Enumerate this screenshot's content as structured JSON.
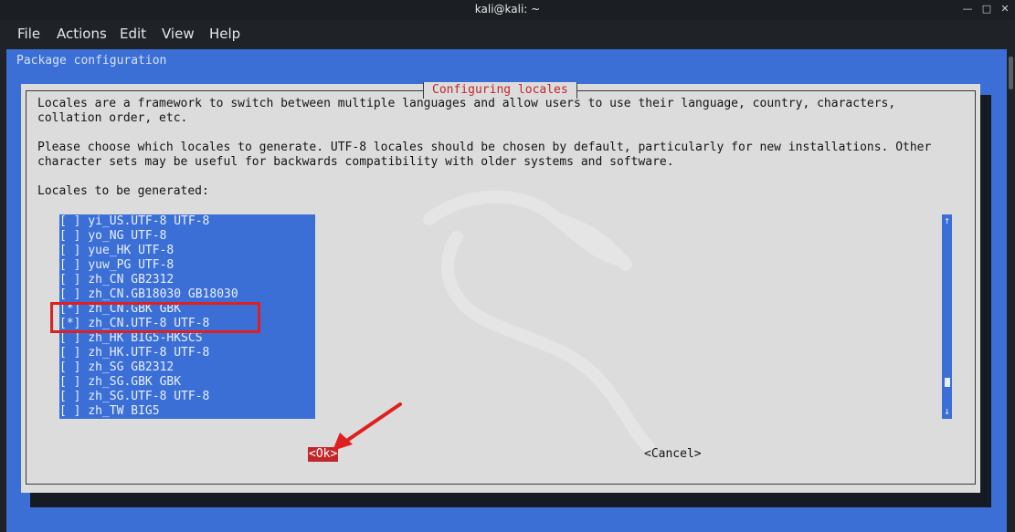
{
  "window": {
    "title": "kali@kali: ~"
  },
  "menu": {
    "items": [
      "File",
      "Actions",
      "Edit",
      "View",
      "Help"
    ]
  },
  "terminal": {
    "package_configuration": "Package configuration",
    "dialog": {
      "title": "Configuring locales",
      "paragraph1_line1": "Locales are a framework to switch between multiple languages and allow users to use their language, country, characters,",
      "paragraph1_line2": "collation order, etc.",
      "paragraph2_line1": "Please choose which locales to generate. UTF-8 locales should be chosen by default, particularly for new installations. Other",
      "paragraph2_line2": "character sets may be useful for backwards compatibility with older systems and software.",
      "list_label": "Locales to be generated:",
      "locales": [
        {
          "mark": "[ ]",
          "label": "yi_US.UTF-8 UTF-8"
        },
        {
          "mark": "[ ]",
          "label": "yo_NG UTF-8"
        },
        {
          "mark": "[ ]",
          "label": "yue_HK UTF-8"
        },
        {
          "mark": "[ ]",
          "label": "yuw_PG UTF-8"
        },
        {
          "mark": "[ ]",
          "label": "zh_CN GB2312"
        },
        {
          "mark": "[ ]",
          "label": "zh_CN.GB18030 GB18030"
        },
        {
          "mark": "[*]",
          "label": "zh_CN.GBK GBK"
        },
        {
          "mark": "[*]",
          "label": "zh_CN.UTF-8 UTF-8"
        },
        {
          "mark": "[ ]",
          "label": "zh_HK BIG5-HKSCS"
        },
        {
          "mark": "[ ]",
          "label": "zh_HK.UTF-8 UTF-8"
        },
        {
          "mark": "[ ]",
          "label": "zh_SG GB2312"
        },
        {
          "mark": "[ ]",
          "label": "zh_SG.GBK GBK"
        },
        {
          "mark": "[ ]",
          "label": "zh_SG.UTF-8 UTF-8"
        },
        {
          "mark": "[ ]",
          "label": "zh_TW BIG5"
        }
      ],
      "ok_label": "<Ok>",
      "cancel_label": "<Cancel>",
      "scroll_up": "↑",
      "scroll_down": "↓"
    }
  },
  "colors": {
    "terminal_bg": "#3b6fd6",
    "dialog_bg": "#dcdcdc",
    "title_text": "#c2262b",
    "ok_bg": "#c2262b",
    "annotation": "#e02020"
  },
  "icons": [
    "minimize-icon",
    "maximize-icon",
    "close-icon",
    "kali-dragon-watermark",
    "annotation-arrow"
  ]
}
